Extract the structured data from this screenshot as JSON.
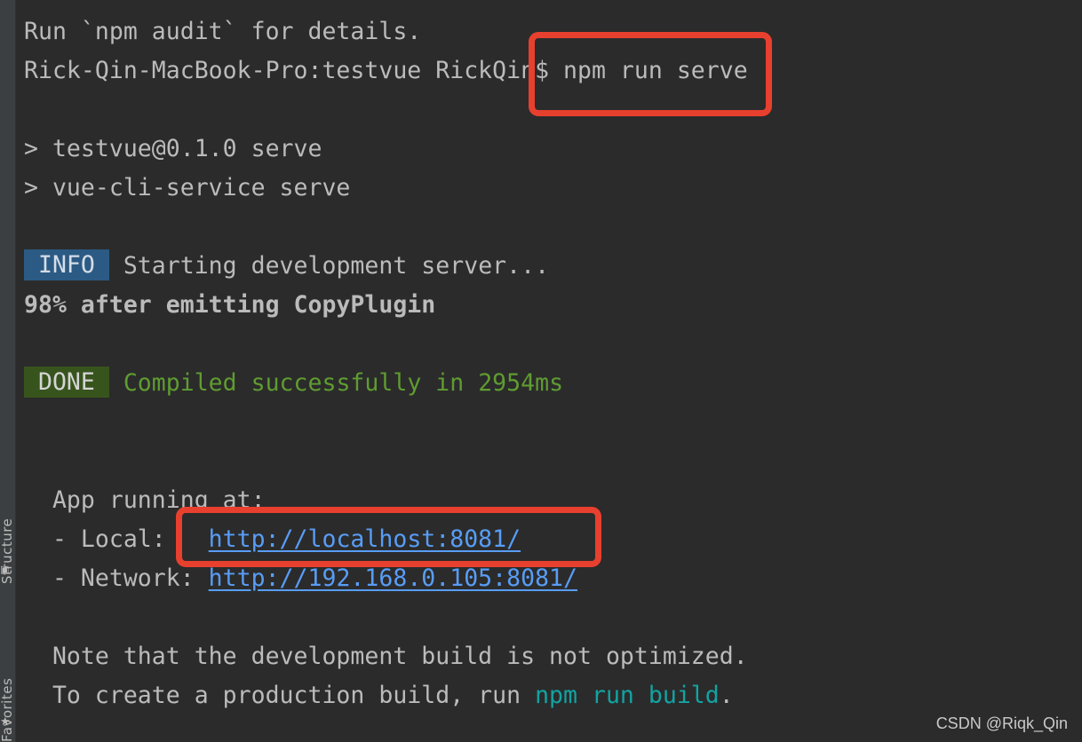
{
  "sidebar": {
    "tabs": [
      {
        "label": "Structure"
      },
      {
        "label": "Favorites"
      }
    ]
  },
  "terminal": {
    "line_audit": "Run `npm audit` for details.",
    "prompt": "Rick-Qin-MacBook-Pro:testvue RickQin$ ",
    "command": "npm run serve",
    "script_name": "> testvue@0.1.0 serve",
    "script_cmd": "> vue-cli-service serve",
    "info_badge": " INFO ",
    "info_text": " Starting development server...",
    "progress": "98% after emitting CopyPlugin",
    "done_badge": " DONE ",
    "done_text": " Compiled successfully in 2954ms",
    "app_running": "  App running at:",
    "local_label": "  - Local:   ",
    "local_url": "http://localhost:8081/",
    "network_label": "  - Network: ",
    "network_url": "http://192.168.0.105:8081/",
    "note_line": "  Note that the development build is not optimized.",
    "build_prefix": "  To create a production build, run ",
    "build_cmd": "npm run build",
    "build_suffix": "."
  },
  "watermark": "CSDN @Riqk_Qin",
  "colors": {
    "background": "#2b2b2b",
    "text": "#bbbbbb",
    "info_badge_bg": "#2b5a84",
    "done_badge_bg": "#38541d",
    "success_green": "#5f9c31",
    "link_blue": "#589df6",
    "command_cyan": "#13a3a3",
    "highlight_red": "#e8402e"
  }
}
